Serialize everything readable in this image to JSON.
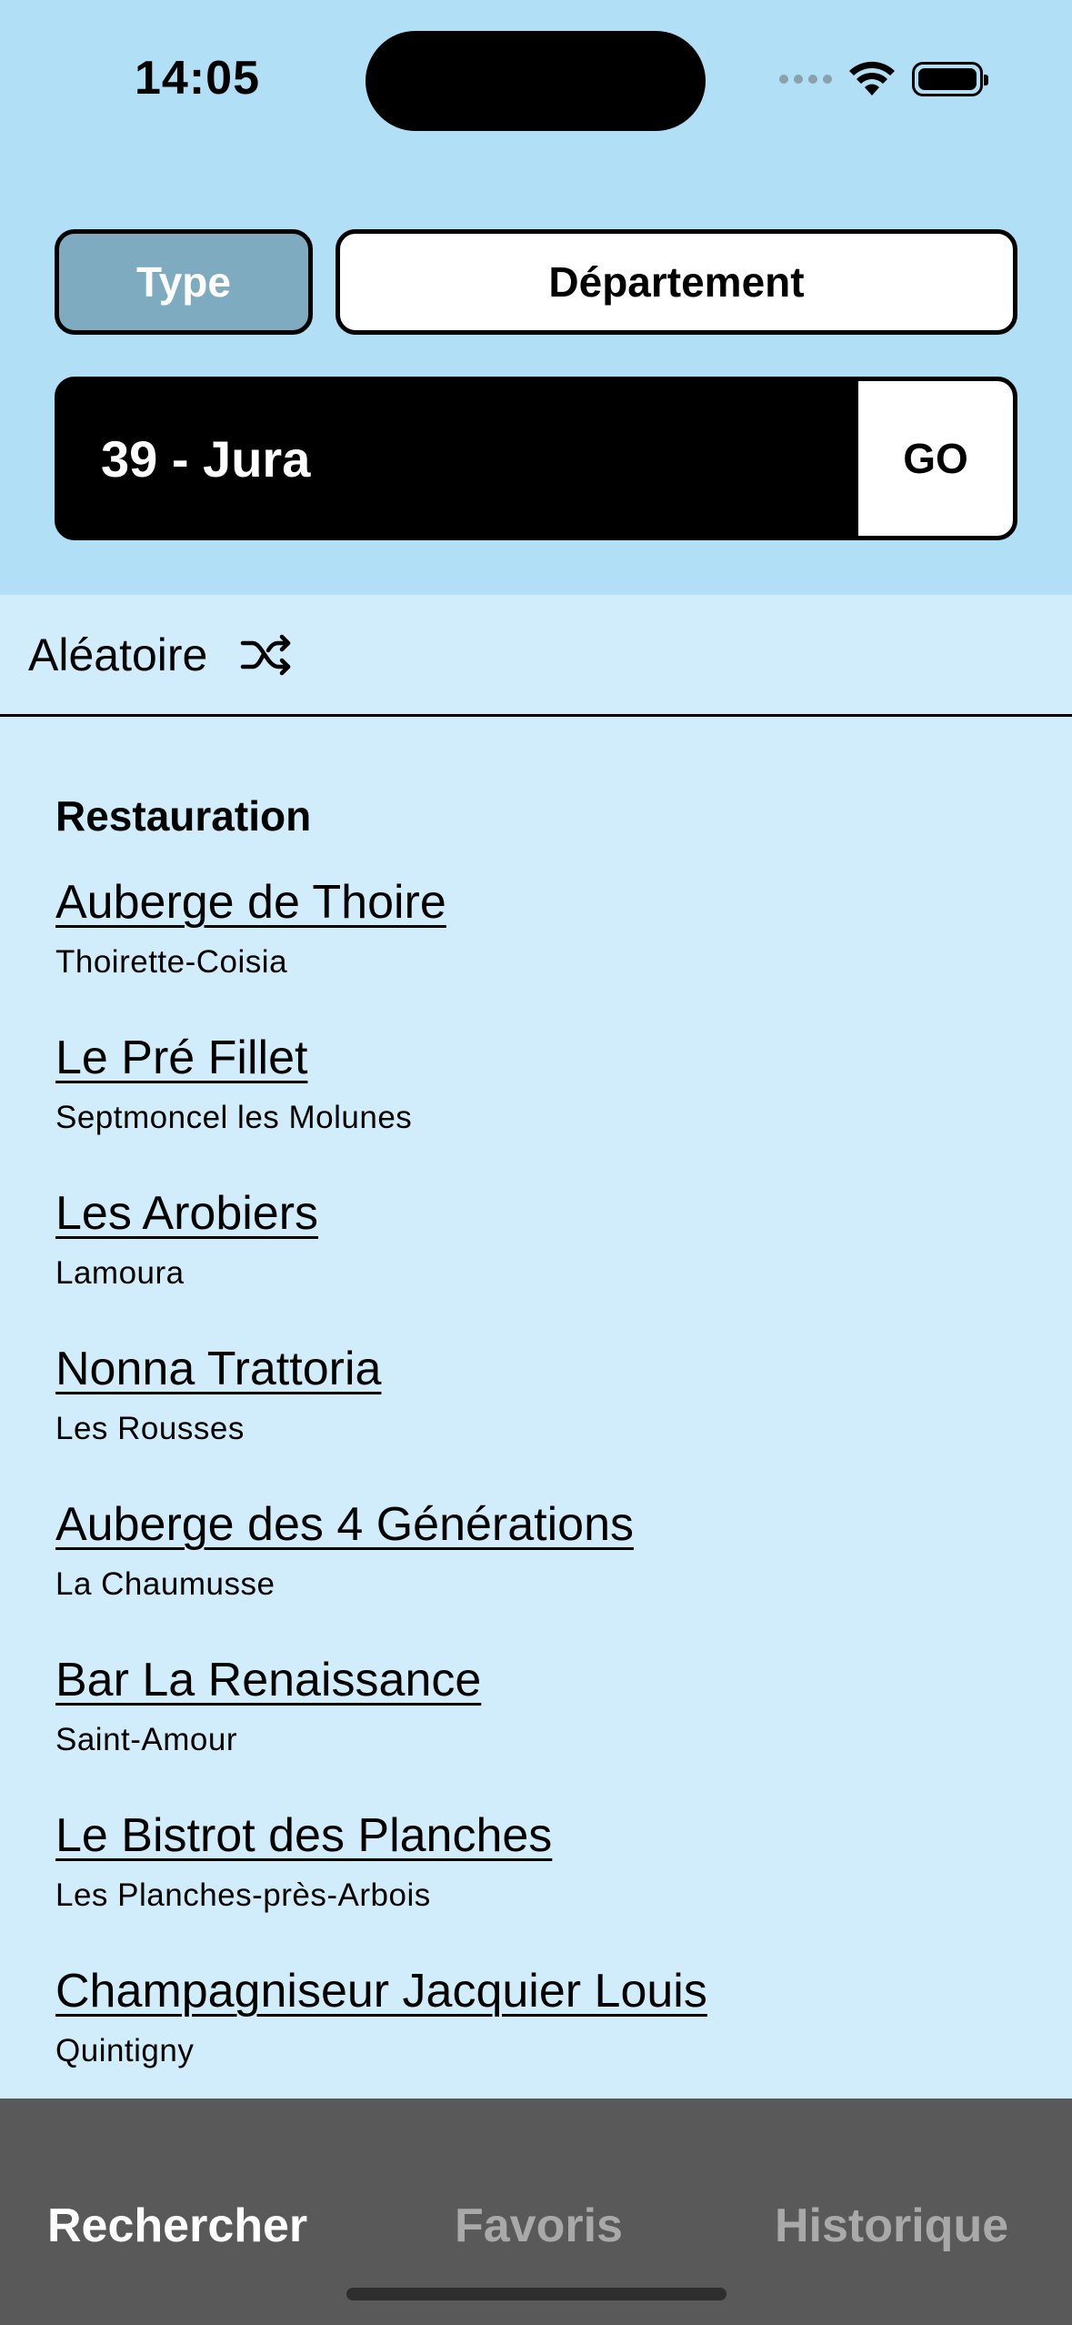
{
  "status_bar": {
    "time": "14:05"
  },
  "filters": {
    "type_label": "Type",
    "department_label": "Département"
  },
  "search": {
    "value": "39 - Jura",
    "go_label": "GO"
  },
  "random": {
    "label": "Aléatoire"
  },
  "section": {
    "title": "Restauration"
  },
  "items": [
    {
      "name": "Auberge de Thoire",
      "city": "Thoirette-Coisia"
    },
    {
      "name": "Le Pré Fillet",
      "city": "Septmoncel les Molunes"
    },
    {
      "name": "Les Arobiers",
      "city": "Lamoura"
    },
    {
      "name": "Nonna Trattoria",
      "city": "Les Rousses"
    },
    {
      "name": "Auberge des 4 Générations",
      "city": "La Chaumusse"
    },
    {
      "name": "Bar La Renaissance",
      "city": "Saint-Amour"
    },
    {
      "name": "Le Bistrot des Planches",
      "city": "Les Planches-près-Arbois"
    },
    {
      "name": "Champagniseur Jacquier Louis",
      "city": "Quintigny"
    }
  ],
  "tabs": {
    "search": "Rechercher",
    "favorites": "Favoris",
    "history": "Historique"
  },
  "colors": {
    "header_bg": "#b0dff6",
    "content_bg": "#d1ecfa",
    "selected_segment": "#7fabc0",
    "tabbar_bg": "#595959",
    "tab_inactive": "#a9a9a9"
  }
}
